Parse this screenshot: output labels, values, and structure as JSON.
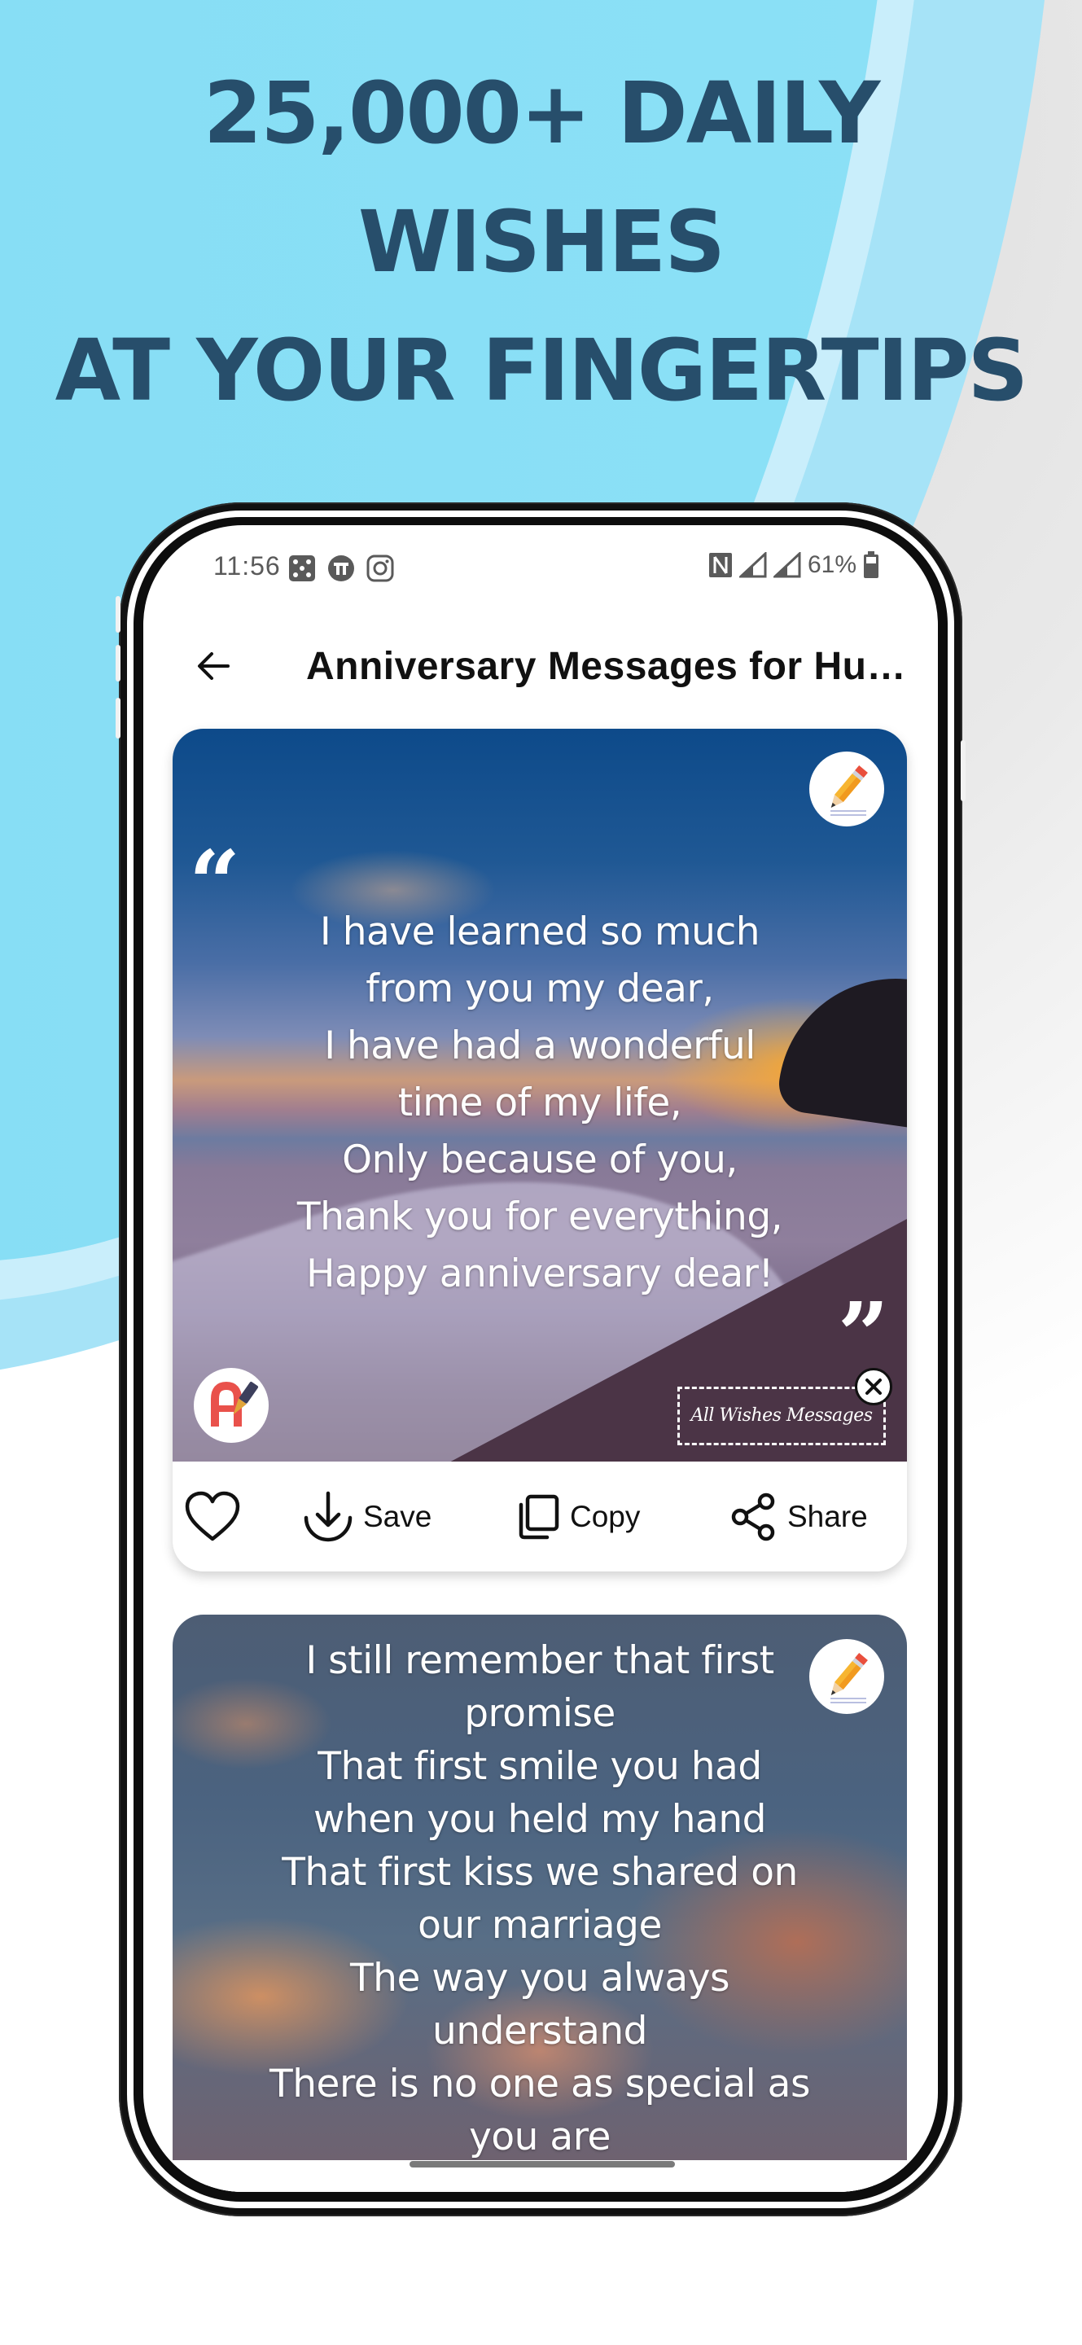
{
  "promo": {
    "headline_lines": [
      "25,000+ DAILY",
      "WISHES",
      "AT YOUR FINGERTIPS"
    ],
    "colors": {
      "headline": "#274e6b",
      "background_blue": "#87def5",
      "background_light_blue": "#a6e3f7"
    }
  },
  "status_bar": {
    "time": "11:56",
    "notification_icons": [
      "dice-icon",
      "app-circle-icon",
      "instagram-icon"
    ],
    "system_icons": [
      "nfc-icon",
      "signal-icon",
      "signal-icon"
    ],
    "battery_percent": "61%"
  },
  "app_bar": {
    "back_icon": "arrow-left-icon",
    "title": "Anniversary Messages for Husband"
  },
  "cards": [
    {
      "message_lines": [
        "I have learned so much",
        "from you my dear,",
        "I have had a wonderful",
        "time of my life,",
        "Only because of you,",
        "Thank you for everything,",
        "Happy anniversary dear!"
      ],
      "open_quote": "“",
      "close_quote": "”",
      "background": "beach sunset",
      "edit_icon": "pencil-icon",
      "logo_icon": "app-logo-icon",
      "watermark_label": "All Wishes Messages",
      "watermark_close_icon": "close-icon",
      "actions": {
        "like_icon": "heart-icon",
        "save_label": "Save",
        "copy_label": "Copy",
        "share_label": "Share"
      }
    },
    {
      "message_lines": [
        "I still remember that first",
        "promise",
        "That first smile you had",
        "when you held my hand",
        "That first kiss we shared on",
        "our marriage",
        "The way you always",
        "understand",
        "There is no one as special as",
        "you are"
      ],
      "background": "heart hands sky",
      "edit_icon": "pencil-icon"
    }
  ]
}
